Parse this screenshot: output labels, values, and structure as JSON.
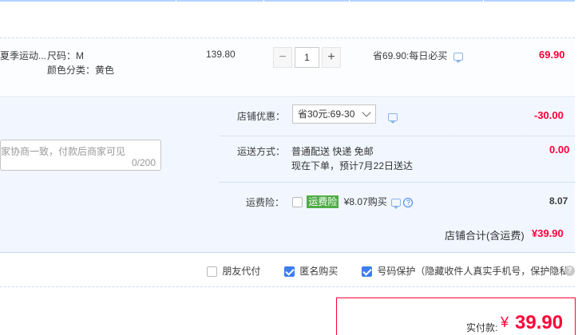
{
  "item": {
    "name_fragment": "夏季运动...",
    "size_label": "尺码：",
    "size_value": "M",
    "color_label": "颜色分类：",
    "color_value": "黄色",
    "unit_price": "139.80",
    "quantity": "1",
    "qty_minus": "−",
    "qty_plus": "+",
    "discount_note": "省69.90:每日必买",
    "subtotal": "69.90"
  },
  "shop": {
    "message_placeholder": "家协商一致，付款后商家可见",
    "message_counter": "0/200",
    "coupon_label": "店铺优惠：",
    "coupon_selected": "省30元:69-30",
    "coupon_amount": "-30.00",
    "shipping_label": "运送方式：",
    "shipping_method": "普通配送 快递 免邮",
    "shipping_eta": "现在下单，预计7月22日送达",
    "shipping_amount": "0.00",
    "insurance_label": "运费险：",
    "insurance_badge": "运费险",
    "insurance_price": "¥8.07购买",
    "insurance_amount": "8.07",
    "total_label": "店铺合计(含运费)",
    "total_value": "¥39.90"
  },
  "options": {
    "friend_pay": "朋友代付",
    "anonymous": "匿名购买",
    "number_protect": "号码保护（隐藏收件人真实手机号，保护隐私）",
    "help": "?"
  },
  "payment": {
    "label": "实付款:",
    "currency": "¥",
    "amount": "39.90"
  },
  "colors": {
    "accent_red": "#ff0036",
    "accent_blue": "#3e7df1",
    "shop_bg": "#f2f7ff"
  }
}
